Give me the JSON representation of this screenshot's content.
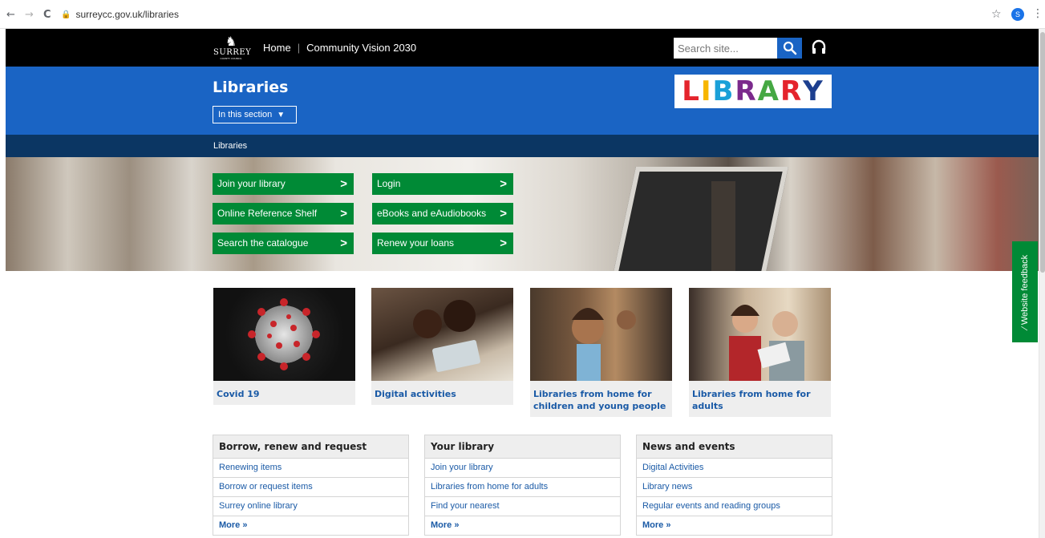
{
  "browser": {
    "back_glyph": "←",
    "forward_glyph": "→",
    "reload_glyph": "C",
    "url": "surreycc.gov.uk/libraries",
    "profile_initial": "S"
  },
  "header": {
    "logo_name": "SURREY",
    "logo_sub": "COUNTY COUNCIL",
    "nav": [
      "Home",
      "Community Vision 2030"
    ],
    "search_placeholder": "Search site..."
  },
  "title_band": {
    "title": "Libraries",
    "section_button": "In this section",
    "library_logo_letters": [
      {
        "ch": "L",
        "color": "#e4242c"
      },
      {
        "ch": "I",
        "color": "#f7b600"
      },
      {
        "ch": "B",
        "color": "#1aa0d8"
      },
      {
        "ch": "R",
        "color": "#7b2a8c"
      },
      {
        "ch": "A",
        "color": "#45a843"
      },
      {
        "ch": "R",
        "color": "#e4242c"
      },
      {
        "ch": "Y",
        "color": "#1d3f8f"
      }
    ]
  },
  "breadcrumb": "Libraries",
  "quick_links": [
    "Join your library",
    "Online Reference Shelf",
    "Search the catalogue",
    "Login",
    "eBooks and eAudiobooks",
    "Renew your loans"
  ],
  "cards": [
    {
      "label": "Covid 19",
      "icon": "virus-image"
    },
    {
      "label": "Digital activities",
      "icon": "children-tablet-image"
    },
    {
      "label": "Libraries from home for children and young people",
      "icon": "child-excited-image"
    },
    {
      "label": "Libraries from home for adults",
      "icon": "adults-tablet-image"
    }
  ],
  "panels": [
    {
      "title": "Borrow, renew and request",
      "items": [
        "Renewing items",
        "Borrow or request items",
        "Surrey online library"
      ],
      "more": "More »"
    },
    {
      "title": "Your library",
      "items": [
        "Join your library",
        "Libraries from home for adults",
        "Find your nearest"
      ],
      "more": "More »"
    },
    {
      "title": "News and events",
      "items": [
        "Digital Activities",
        "Library news",
        "Regular events and reading groups"
      ],
      "more": "More »"
    }
  ],
  "feedback": "Website feedback",
  "colors": {
    "topbar": "#000000",
    "blue": "#1a64c4",
    "navy": "#0b3663",
    "green": "#008a36",
    "link": "#1a5aa6"
  }
}
